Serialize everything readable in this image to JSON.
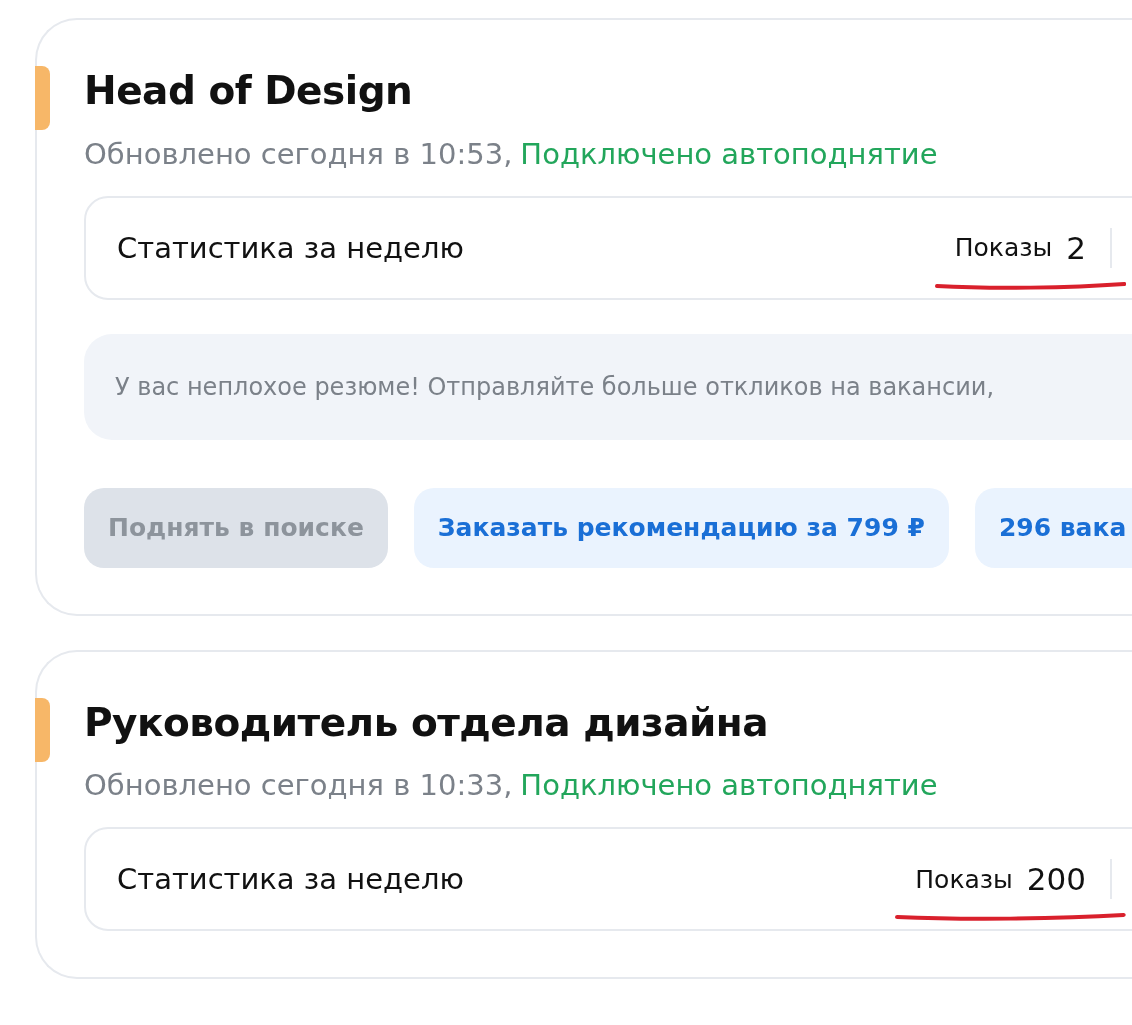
{
  "resumes": [
    {
      "title": "Head of Design",
      "updated": "Обновлено сегодня в 10:53,",
      "autoraise": "Подключено автоподнятие",
      "stats": {
        "label": "Статистика за неделю",
        "metric_label": "Показы",
        "metric_value": "2",
        "underlined": true
      },
      "hint": "У вас неплохое резюме! Отправляйте больше откликов на вакансии,",
      "buttons": [
        {
          "label": "Поднять в поиске",
          "disabled": true
        },
        {
          "label": "Заказать рекомендацию за 799 ₽",
          "disabled": false
        },
        {
          "label": "296 вака",
          "disabled": false
        }
      ]
    },
    {
      "title": "Руководитель отдела дизайна",
      "updated": "Обновлено сегодня в 10:33,",
      "autoraise": "Подключено автоподнятие",
      "stats": {
        "label": "Статистика за неделю",
        "metric_label": "Показы",
        "metric_value": "200",
        "underlined": true
      }
    }
  ]
}
